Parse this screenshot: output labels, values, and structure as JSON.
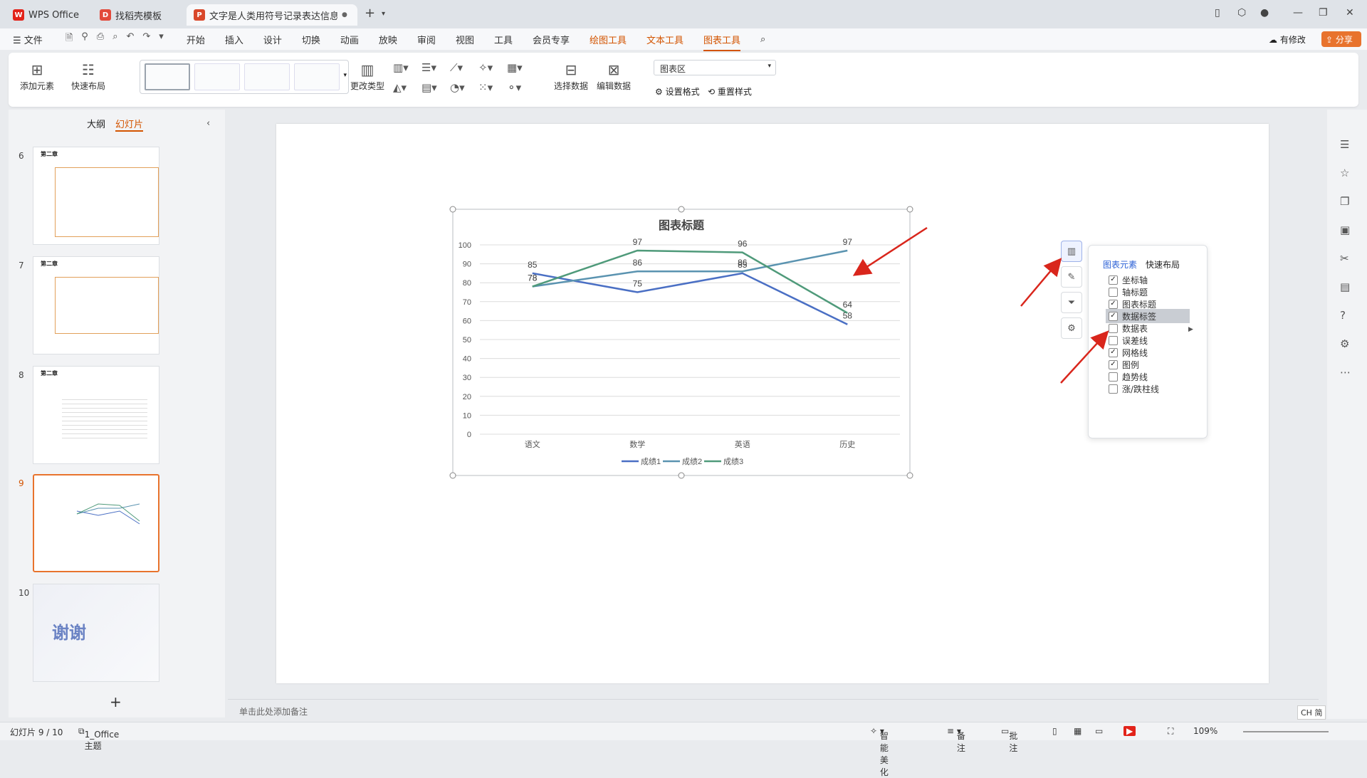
{
  "tabs": [
    {
      "label": "WPS Office"
    },
    {
      "label": "找稻壳模板"
    },
    {
      "label": "文字是人类用符号记录表达信息以"
    }
  ],
  "menu": [
    "文件",
    "开始",
    "插入",
    "设计",
    "切换",
    "动画",
    "放映",
    "审阅",
    "视图",
    "工具",
    "会员专享",
    "绘图工具",
    "文本工具",
    "图表工具"
  ],
  "menu_right": {
    "modify": "有修改",
    "share": "分享"
  },
  "toolbar": {
    "add_element": "添加元素",
    "quick_layout": "快速布局",
    "change_type": "更改类型",
    "select_data": "选择数据",
    "edit_data": "编辑数据",
    "area_select": "图表区",
    "set_format": "设置格式",
    "reset_style": "重置样式"
  },
  "panel": {
    "outline": "大纲",
    "slides": "幻灯片"
  },
  "slides": [
    {
      "num": "6",
      "title": "第二章"
    },
    {
      "num": "7",
      "title": "第二章"
    },
    {
      "num": "8",
      "title": "第二章"
    },
    {
      "num": "9",
      "title": ""
    },
    {
      "num": "10",
      "title": "谢谢"
    }
  ],
  "chart_data": {
    "type": "line",
    "title": "图表标题",
    "categories": [
      "语文",
      "数学",
      "英语",
      "历史"
    ],
    "series": [
      {
        "name": "成绩1",
        "values": [
          85,
          75,
          85,
          58
        ],
        "color": "#4a6fc4"
      },
      {
        "name": "成绩2",
        "values": [
          78,
          86,
          86,
          97
        ],
        "color": "#5a93b0"
      },
      {
        "name": "成绩3",
        "values": [
          78,
          97,
          96,
          64
        ],
        "color": "#4f9a7a"
      }
    ],
    "ylim": [
      0,
      100
    ],
    "yticks": [
      "0",
      "10",
      "20",
      "30",
      "40",
      "50",
      "60",
      "70",
      "80",
      "90",
      "100"
    ],
    "grid": true,
    "legend": "bottom",
    "data_labels": true
  },
  "chart_popup": {
    "tab_elements": "图表元素",
    "tab_layout": "快速布局",
    "options": [
      {
        "label": "坐标轴",
        "checked": true
      },
      {
        "label": "轴标题",
        "checked": false
      },
      {
        "label": "图表标题",
        "checked": true
      },
      {
        "label": "数据标签",
        "checked": true
      },
      {
        "label": "数据表",
        "checked": false
      },
      {
        "label": "误差线",
        "checked": false
      },
      {
        "label": "网格线",
        "checked": true
      },
      {
        "label": "图例",
        "checked": true
      },
      {
        "label": "趋势线",
        "checked": false
      },
      {
        "label": "涨/跌柱线",
        "checked": false
      }
    ]
  },
  "notes": "单击此处添加备注",
  "status": {
    "slide_info": "幻灯片 9 / 10",
    "theme": "1_Office 主题",
    "beautify": "智能美化",
    "notes": "备注",
    "comments": "批注",
    "zoom": "109%",
    "ime": "CH 简"
  },
  "colors": {
    "accent": "#d35400",
    "selection": "#e8732d",
    "arrow": "#d9261c"
  }
}
